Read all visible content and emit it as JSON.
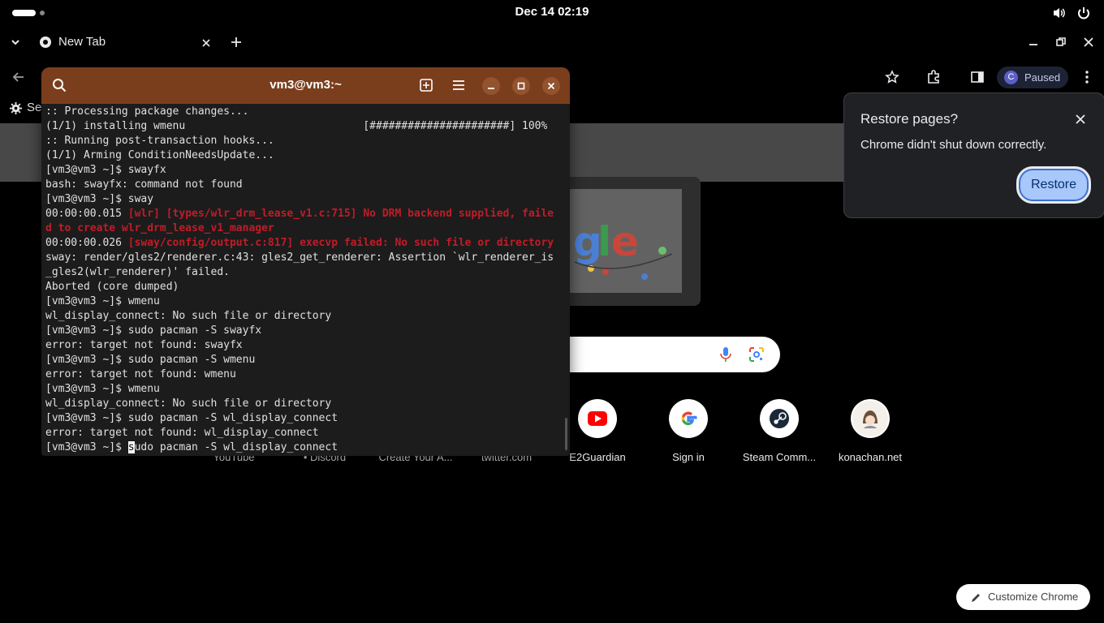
{
  "topbar": {
    "clock": "Dec 14  02:19"
  },
  "chrome": {
    "tab_title": "New Tab",
    "profile_initial": "C",
    "profile_label": "Paused",
    "bookmarks_label": "Se"
  },
  "restore_popup": {
    "title": "Restore pages?",
    "message": "Chrome didn't shut down correctly.",
    "button": "Restore"
  },
  "shortcuts": [
    {
      "label": "YouTube"
    },
    {
      "label": "• Discord"
    },
    {
      "label": "Create Your A..."
    },
    {
      "label": "twitter.com"
    },
    {
      "label": "E2Guardian"
    },
    {
      "label": "Sign in"
    },
    {
      "label": "Steam Comm..."
    },
    {
      "label": "konachan.net"
    }
  ],
  "customize_label": "Customize Chrome",
  "terminal": {
    "title": "vm3@vm3:~",
    "lines": [
      {
        "text": ":: Processing package changes...",
        "type": "normal"
      },
      {
        "text": "(1/1) installing wmenu                            [######################] 100%",
        "type": "normal"
      },
      {
        "text": ":: Running post-transaction hooks...",
        "type": "normal"
      },
      {
        "text": "(1/1) Arming ConditionNeedsUpdate...",
        "type": "normal"
      },
      {
        "text": "[vm3@vm3 ~]$ swayfx",
        "type": "normal"
      },
      {
        "text": "bash: swayfx: command not found",
        "type": "normal"
      },
      {
        "text": "[vm3@vm3 ~]$ sway",
        "type": "normal"
      },
      {
        "prefix": "00:00:00.015 ",
        "text": "[wlr] [types/wlr_drm_lease_v1.c:715] No DRM backend supplied, faile",
        "type": "error"
      },
      {
        "prefix": "",
        "text": "d to create wlr_drm_lease_v1_manager",
        "type": "error"
      },
      {
        "prefix": "00:00:00.026 ",
        "text": "[sway/config/output.c:817] execvp failed: No such file or directory",
        "type": "error"
      },
      {
        "text": "sway: render/gles2/renderer.c:43: gles2_get_renderer: Assertion `wlr_renderer_is",
        "type": "normal"
      },
      {
        "text": "_gles2(wlr_renderer)' failed.",
        "type": "normal"
      },
      {
        "text": "Aborted (core dumped)",
        "type": "normal"
      },
      {
        "text": "[vm3@vm3 ~]$ wmenu",
        "type": "normal"
      },
      {
        "text": "wl_display_connect: No such file or directory",
        "type": "normal"
      },
      {
        "text": "[vm3@vm3 ~]$ sudo pacman -S swayfx",
        "type": "normal"
      },
      {
        "text": "error: target not found: swayfx",
        "type": "normal"
      },
      {
        "text": "[vm3@vm3 ~]$ sudo pacman -S wmenu",
        "type": "normal"
      },
      {
        "text": "error: target not found: wmenu",
        "type": "normal"
      },
      {
        "text": "[vm3@vm3 ~]$ wmenu",
        "type": "normal"
      },
      {
        "text": "wl_display_connect: No such file or directory",
        "type": "normal"
      },
      {
        "text": "[vm3@vm3 ~]$ sudo pacman -S wl_display_connect",
        "type": "normal"
      },
      {
        "text": "error: target not found: wl_display_connect",
        "type": "normal"
      }
    ],
    "prompt_prefix": "[vm3@vm3 ~]$ ",
    "prompt_cursor_char": "s",
    "prompt_rest": "udo pacman -S wl_display_connect"
  },
  "colors": {
    "terminal_header": "#7a3e1d",
    "error_text": "#c01c28",
    "restore_button": "#a8c7fa"
  }
}
